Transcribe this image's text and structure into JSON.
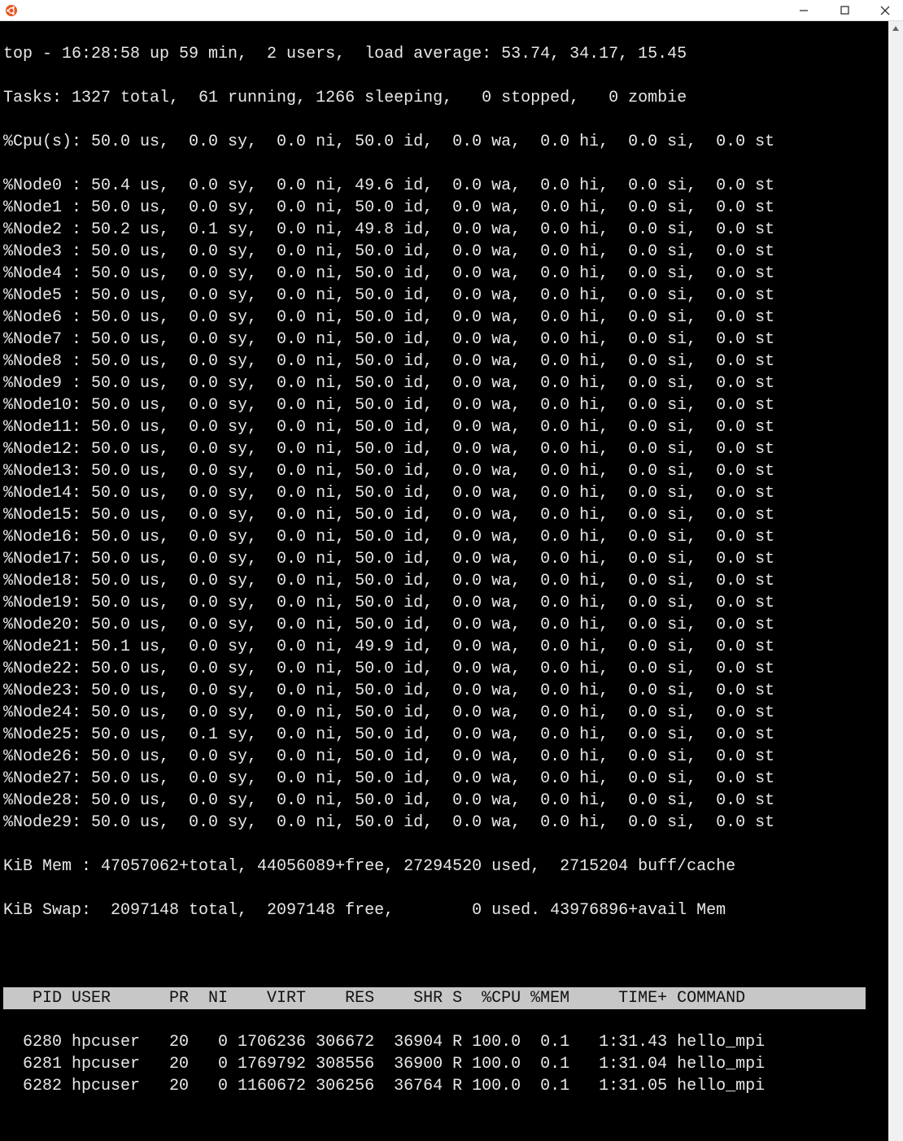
{
  "window": {
    "app_icon": "ubuntu-icon",
    "minimize": "–",
    "maximize": "☐",
    "close": "✕"
  },
  "top": {
    "summary": "top - 16:28:58 up 59 min,  2 users,  load average: 53.74, 34.17, 15.45",
    "tasks": "Tasks: 1327 total,  61 running, 1266 sleeping,   0 stopped,   0 zombie",
    "cpu": "%Cpu(s): 50.0 us,  0.0 sy,  0.0 ni, 50.0 id,  0.0 wa,  0.0 hi,  0.0 si,  0.0 st",
    "nodes": [
      "%Node0 : 50.4 us,  0.0 sy,  0.0 ni, 49.6 id,  0.0 wa,  0.0 hi,  0.0 si,  0.0 st",
      "%Node1 : 50.0 us,  0.0 sy,  0.0 ni, 50.0 id,  0.0 wa,  0.0 hi,  0.0 si,  0.0 st",
      "%Node2 : 50.2 us,  0.1 sy,  0.0 ni, 49.8 id,  0.0 wa,  0.0 hi,  0.0 si,  0.0 st",
      "%Node3 : 50.0 us,  0.0 sy,  0.0 ni, 50.0 id,  0.0 wa,  0.0 hi,  0.0 si,  0.0 st",
      "%Node4 : 50.0 us,  0.0 sy,  0.0 ni, 50.0 id,  0.0 wa,  0.0 hi,  0.0 si,  0.0 st",
      "%Node5 : 50.0 us,  0.0 sy,  0.0 ni, 50.0 id,  0.0 wa,  0.0 hi,  0.0 si,  0.0 st",
      "%Node6 : 50.0 us,  0.0 sy,  0.0 ni, 50.0 id,  0.0 wa,  0.0 hi,  0.0 si,  0.0 st",
      "%Node7 : 50.0 us,  0.0 sy,  0.0 ni, 50.0 id,  0.0 wa,  0.0 hi,  0.0 si,  0.0 st",
      "%Node8 : 50.0 us,  0.0 sy,  0.0 ni, 50.0 id,  0.0 wa,  0.0 hi,  0.0 si,  0.0 st",
      "%Node9 : 50.0 us,  0.0 sy,  0.0 ni, 50.0 id,  0.0 wa,  0.0 hi,  0.0 si,  0.0 st",
      "%Node10: 50.0 us,  0.0 sy,  0.0 ni, 50.0 id,  0.0 wa,  0.0 hi,  0.0 si,  0.0 st",
      "%Node11: 50.0 us,  0.0 sy,  0.0 ni, 50.0 id,  0.0 wa,  0.0 hi,  0.0 si,  0.0 st",
      "%Node12: 50.0 us,  0.0 sy,  0.0 ni, 50.0 id,  0.0 wa,  0.0 hi,  0.0 si,  0.0 st",
      "%Node13: 50.0 us,  0.0 sy,  0.0 ni, 50.0 id,  0.0 wa,  0.0 hi,  0.0 si,  0.0 st",
      "%Node14: 50.0 us,  0.0 sy,  0.0 ni, 50.0 id,  0.0 wa,  0.0 hi,  0.0 si,  0.0 st",
      "%Node15: 50.0 us,  0.0 sy,  0.0 ni, 50.0 id,  0.0 wa,  0.0 hi,  0.0 si,  0.0 st",
      "%Node16: 50.0 us,  0.0 sy,  0.0 ni, 50.0 id,  0.0 wa,  0.0 hi,  0.0 si,  0.0 st",
      "%Node17: 50.0 us,  0.0 sy,  0.0 ni, 50.0 id,  0.0 wa,  0.0 hi,  0.0 si,  0.0 st",
      "%Node18: 50.0 us,  0.0 sy,  0.0 ni, 50.0 id,  0.0 wa,  0.0 hi,  0.0 si,  0.0 st",
      "%Node19: 50.0 us,  0.0 sy,  0.0 ni, 50.0 id,  0.0 wa,  0.0 hi,  0.0 si,  0.0 st",
      "%Node20: 50.0 us,  0.0 sy,  0.0 ni, 50.0 id,  0.0 wa,  0.0 hi,  0.0 si,  0.0 st",
      "%Node21: 50.1 us,  0.0 sy,  0.0 ni, 49.9 id,  0.0 wa,  0.0 hi,  0.0 si,  0.0 st",
      "%Node22: 50.0 us,  0.0 sy,  0.0 ni, 50.0 id,  0.0 wa,  0.0 hi,  0.0 si,  0.0 st",
      "%Node23: 50.0 us,  0.0 sy,  0.0 ni, 50.0 id,  0.0 wa,  0.0 hi,  0.0 si,  0.0 st",
      "%Node24: 50.0 us,  0.0 sy,  0.0 ni, 50.0 id,  0.0 wa,  0.0 hi,  0.0 si,  0.0 st",
      "%Node25: 50.0 us,  0.1 sy,  0.0 ni, 50.0 id,  0.0 wa,  0.0 hi,  0.0 si,  0.0 st",
      "%Node26: 50.0 us,  0.0 sy,  0.0 ni, 50.0 id,  0.0 wa,  0.0 hi,  0.0 si,  0.0 st",
      "%Node27: 50.0 us,  0.0 sy,  0.0 ni, 50.0 id,  0.0 wa,  0.0 hi,  0.0 si,  0.0 st",
      "%Node28: 50.0 us,  0.0 sy,  0.0 ni, 50.0 id,  0.0 wa,  0.0 hi,  0.0 si,  0.0 st",
      "%Node29: 50.0 us,  0.0 sy,  0.0 ni, 50.0 id,  0.0 wa,  0.0 hi,  0.0 si,  0.0 st"
    ],
    "mem": "KiB Mem : 47057062+total, 44056089+free, 27294520 used,  2715204 buff/cache",
    "swap": "KiB Swap:  2097148 total,  2097148 free,        0 used. 43976896+avail Mem",
    "blank": " ",
    "table_header": "   PID USER      PR  NI    VIRT    RES    SHR S  %CPU %MEM     TIME+ COMMAND          ",
    "rows": [
      "  6280 hpcuser   20   0 1706236 306672  36904 R 100.0  0.1   1:31.43 hello_mpi",
      "  6281 hpcuser   20   0 1769792 308556  36900 R 100.0  0.1   1:31.04 hello_mpi",
      "  6282 hpcuser   20   0 1160672 306256  36764 R 100.0  0.1   1:31.05 hello_mpi"
    ]
  }
}
